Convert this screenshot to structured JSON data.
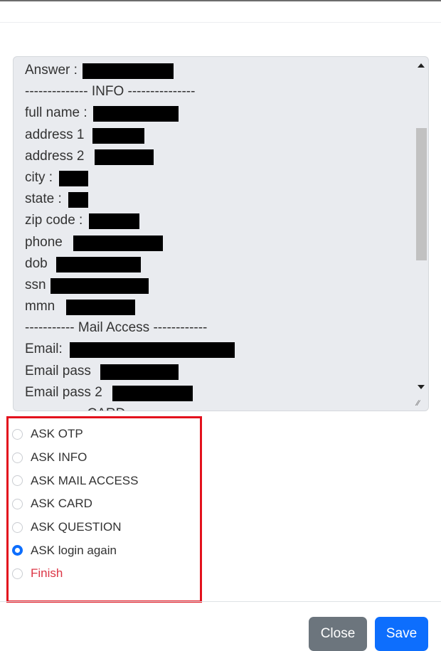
{
  "textarea": {
    "lines": [
      {
        "label": "Answer :",
        "redacted": true
      },
      {
        "label": "-------------- INFO ---------------",
        "redacted": false
      },
      {
        "label": "full name :",
        "redacted": true
      },
      {
        "label": "address 1",
        "redacted": true
      },
      {
        "label": "address 2",
        "redacted": true
      },
      {
        "label": "city :",
        "redacted": true
      },
      {
        "label": "state :",
        "redacted": true
      },
      {
        "label": "zip code :",
        "redacted": true
      },
      {
        "label": "phone",
        "redacted": true
      },
      {
        "label": "dob",
        "redacted": true
      },
      {
        "label": "ssn",
        "redacted": true
      },
      {
        "label": "mmn",
        "redacted": true
      },
      {
        "label": "----------- Mail Access ------------",
        "redacted": false
      },
      {
        "label": "Email:",
        "redacted": true
      },
      {
        "label": "Email pass",
        "redacted": true
      },
      {
        "label": "Email pass 2",
        "redacted": true
      },
      {
        "label": "------------- CARD",
        "redacted": false
      }
    ]
  },
  "options": [
    {
      "label": "ASK OTP",
      "checked": false
    },
    {
      "label": "ASK INFO",
      "checked": false
    },
    {
      "label": "ASK MAIL ACCESS",
      "checked": false
    },
    {
      "label": "ASK CARD",
      "checked": false
    },
    {
      "label": "ASK QUESTION",
      "checked": false
    },
    {
      "label": "ASK login again",
      "checked": true
    },
    {
      "label": "Finish",
      "checked": false,
      "color": "#dc3545"
    }
  ],
  "footer": {
    "close_label": "Close",
    "save_label": "Save"
  },
  "colors": {
    "primary": "#0d6efd",
    "secondary": "#6c757d",
    "highlight": "#e3111d"
  }
}
